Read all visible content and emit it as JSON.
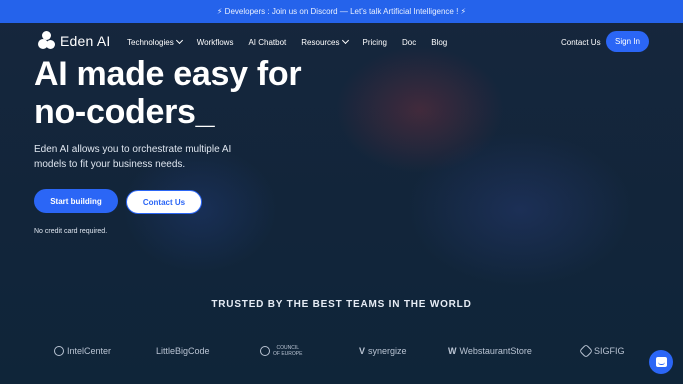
{
  "announcement": "⚡ Developers : Join us on Discord — Let's talk Artificial Intelligence ! ⚡",
  "brand": {
    "name": "Eden AI"
  },
  "nav": {
    "items": [
      {
        "label": "Technologies",
        "dropdown": true
      },
      {
        "label": "Workflows",
        "dropdown": false
      },
      {
        "label": "AI Chatbot",
        "dropdown": false
      },
      {
        "label": "Resources",
        "dropdown": true
      },
      {
        "label": "Pricing",
        "dropdown": false
      },
      {
        "label": "Doc",
        "dropdown": false
      },
      {
        "label": "Blog",
        "dropdown": false
      }
    ],
    "contact_label": "Contact Us",
    "signin_label": "Sign In"
  },
  "hero": {
    "title_line1": "AI made easy for",
    "title_line2": "no-coders_",
    "description": "Eden AI allows you to orchestrate multiple AI models to fit your business needs.",
    "start_button": "Start building",
    "contact_button": "Contact Us",
    "note": "No credit card required."
  },
  "trusted": {
    "heading": "TRUSTED BY THE BEST TEAMS IN THE WORLD",
    "logos": {
      "intelcenter": "IntelCenter",
      "littlebigcode": "LittleBigCode",
      "council_line1": "COUNCIL",
      "council_line2": "OF EUROPE",
      "synergize": "synergize",
      "webstaurant": "WebstaurantStore",
      "sigfig": "SIGFIG"
    }
  },
  "colors": {
    "accent": "#2b66f6",
    "announcement_bg": "#2563eb",
    "background": "#13253a"
  },
  "chat": {
    "icon": "chat-bubble-icon"
  }
}
